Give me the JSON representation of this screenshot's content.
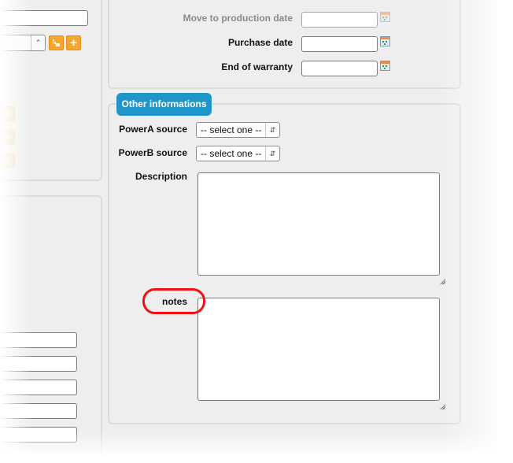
{
  "dates": {
    "move_to_production_label": "Move to production date",
    "move_to_production_value": "",
    "purchase_label": "Purchase date",
    "purchase_value": "",
    "end_of_warranty_label": "End of warranty",
    "end_of_warranty_value": ""
  },
  "other": {
    "section_title": "Other informations",
    "powera_label": "PowerA source",
    "powera_value": "-- select one --",
    "powerb_label": "PowerB source",
    "powerb_value": "-- select one --",
    "description_label": "Description",
    "description_value": "",
    "notes_label": "notes",
    "notes_value": ""
  },
  "left": {
    "add_symbol": "+",
    "select_arrows": "⌃⌄"
  },
  "icons": {
    "calendar": "calendar-icon",
    "tree": "tree-icon",
    "add": "add-icon",
    "highlight_color": "#ee1111",
    "accent_color": "#2096c8",
    "button_color": "#f7a531"
  }
}
